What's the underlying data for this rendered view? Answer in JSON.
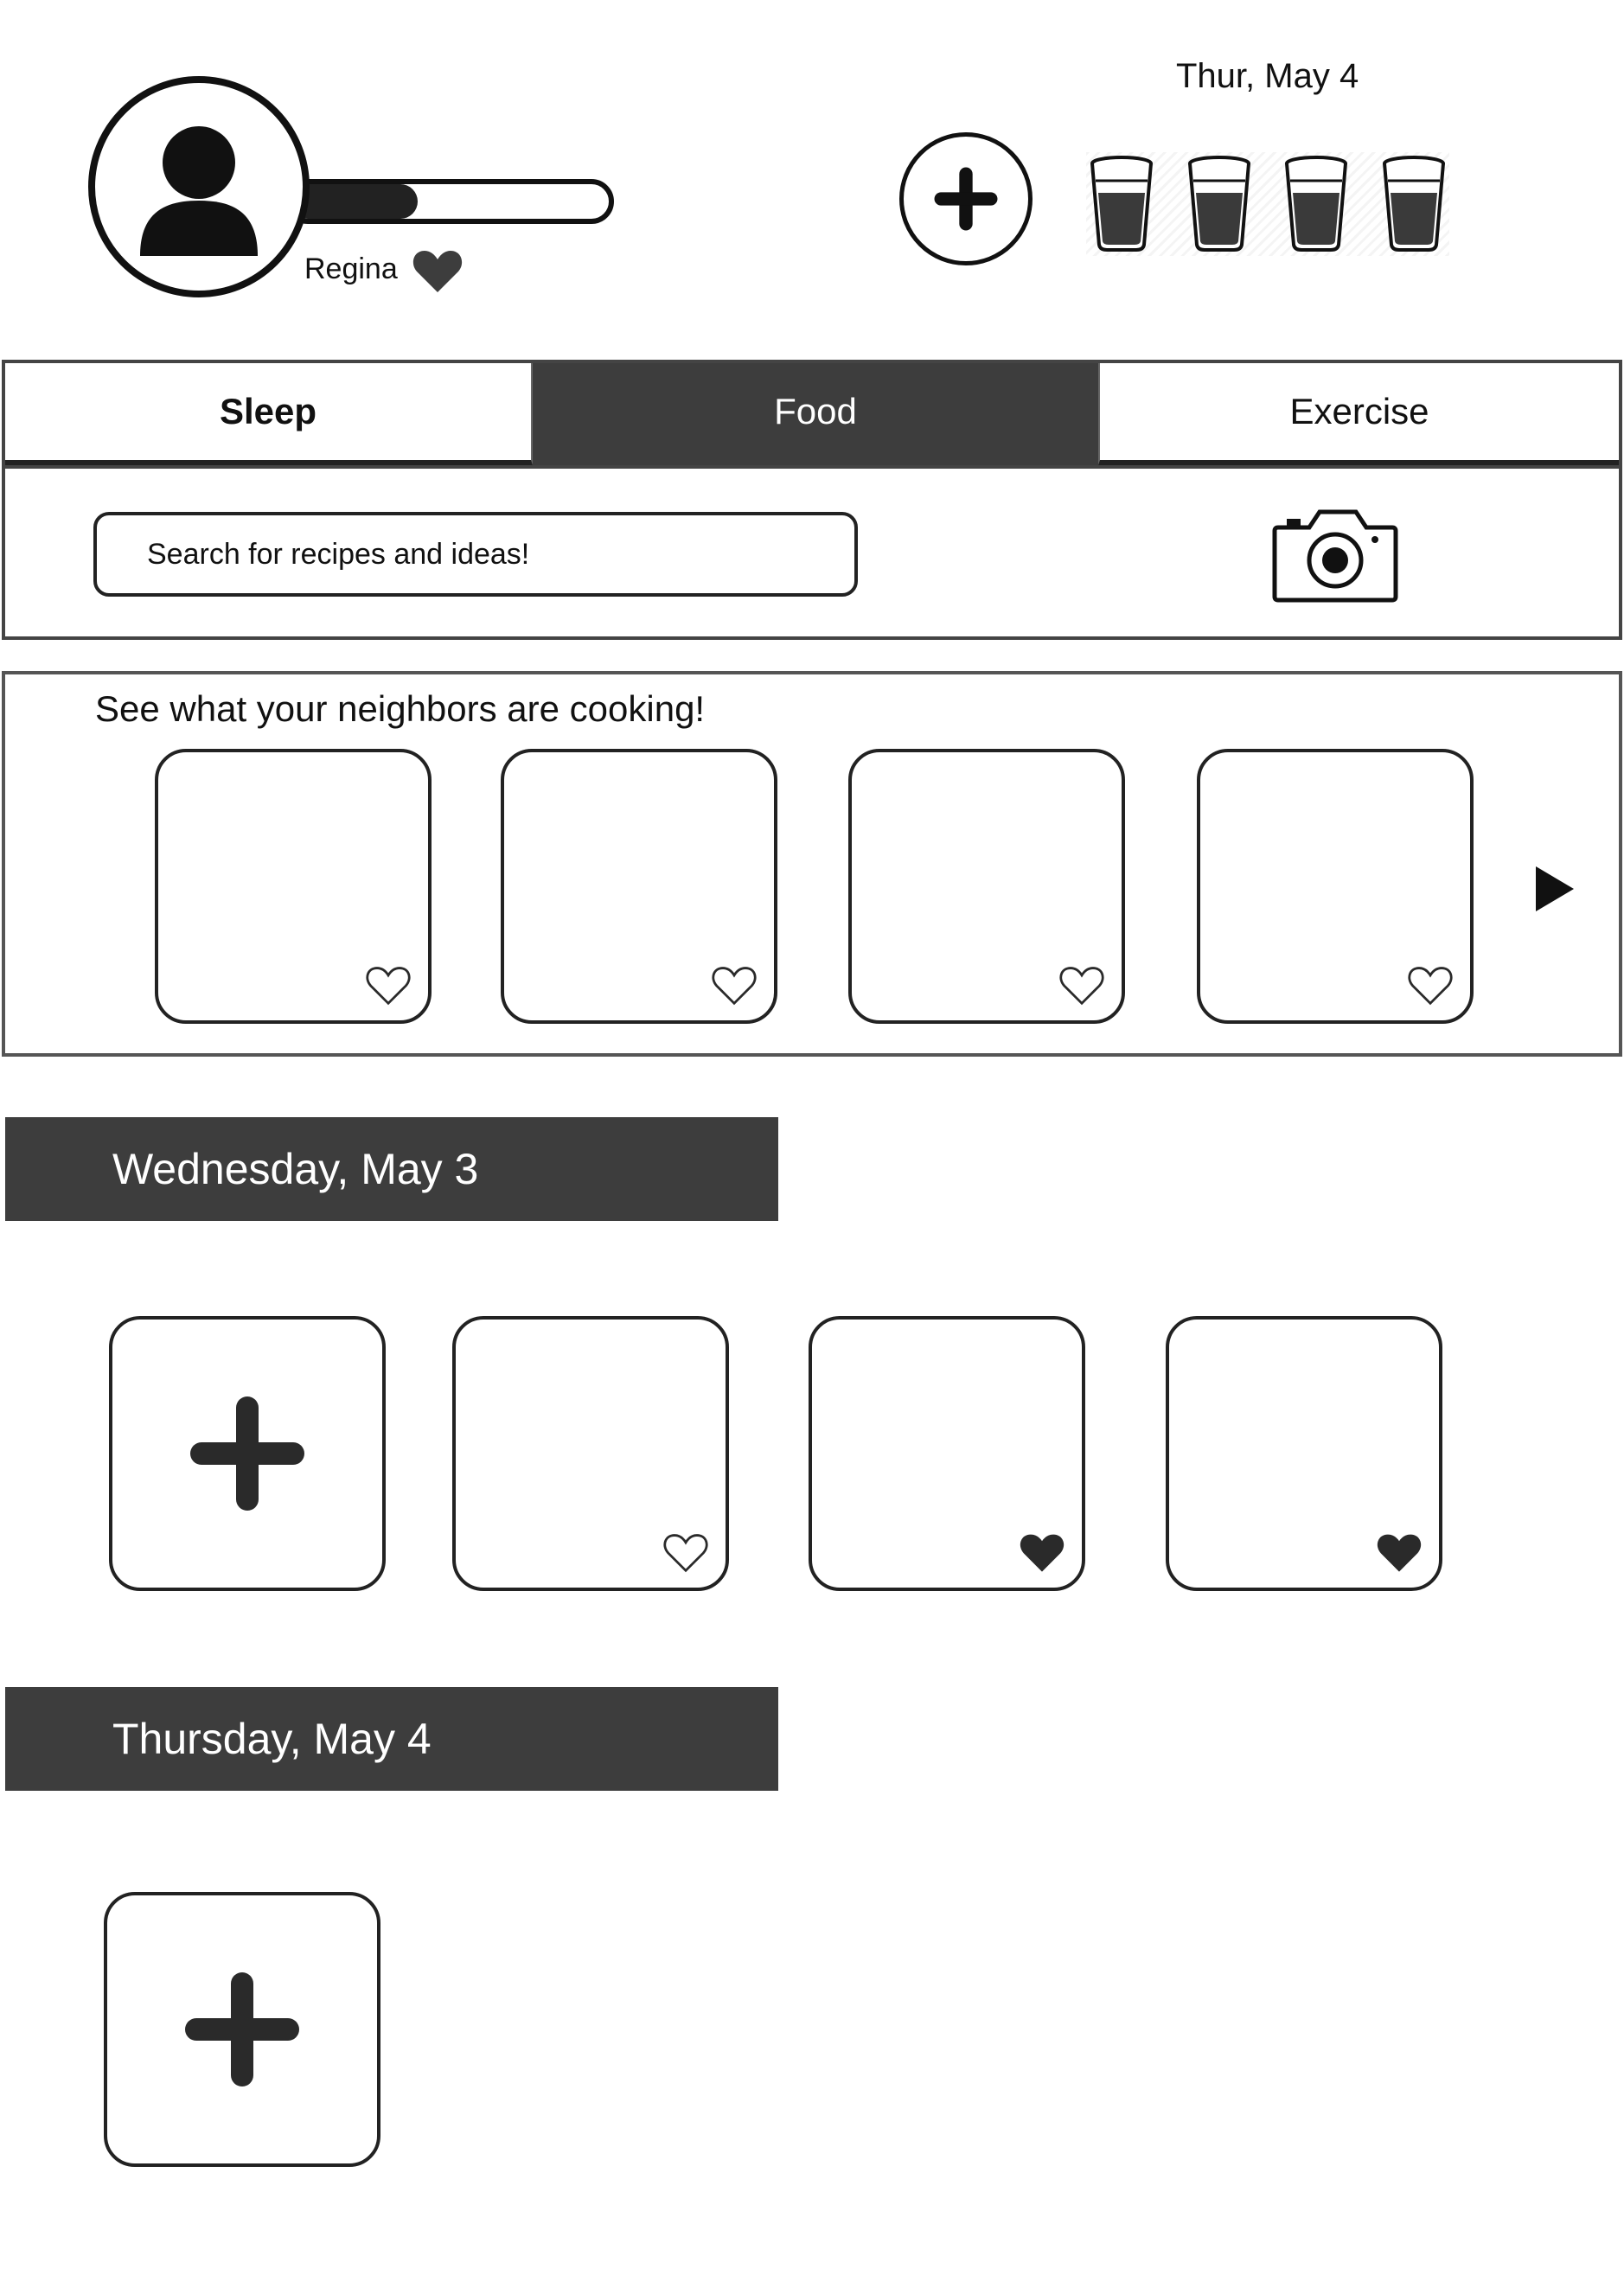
{
  "user": {
    "name": "Regina",
    "progress_percent": 40
  },
  "header": {
    "date": "Thur, May 4",
    "water_glasses_filled": 4
  },
  "tabs": [
    {
      "label": "Sleep",
      "active": false
    },
    {
      "label": "Food",
      "active": true
    },
    {
      "label": "Exercise",
      "active": false
    }
  ],
  "search": {
    "placeholder": "Search for recipes and ideas!"
  },
  "neighbors": {
    "title": "See what your neighbors are cooking!",
    "cards": [
      {
        "liked": false
      },
      {
        "liked": false
      },
      {
        "liked": false
      },
      {
        "liked": false
      }
    ]
  },
  "days": [
    {
      "label": "Wednesday, May 3",
      "entries": [
        {
          "liked": false
        },
        {
          "liked": true
        },
        {
          "liked": true
        }
      ]
    },
    {
      "label": "Thursday, May 4",
      "entries": []
    }
  ],
  "colors": {
    "dark": "#3d3d3d",
    "ink": "#111111",
    "background": "#ffffff"
  },
  "icons": {
    "avatar": "person-icon",
    "add": "plus-icon",
    "water": "water-glass-icon",
    "favorite": "heart-icon",
    "camera": "camera-icon",
    "next": "play-arrow-icon"
  }
}
